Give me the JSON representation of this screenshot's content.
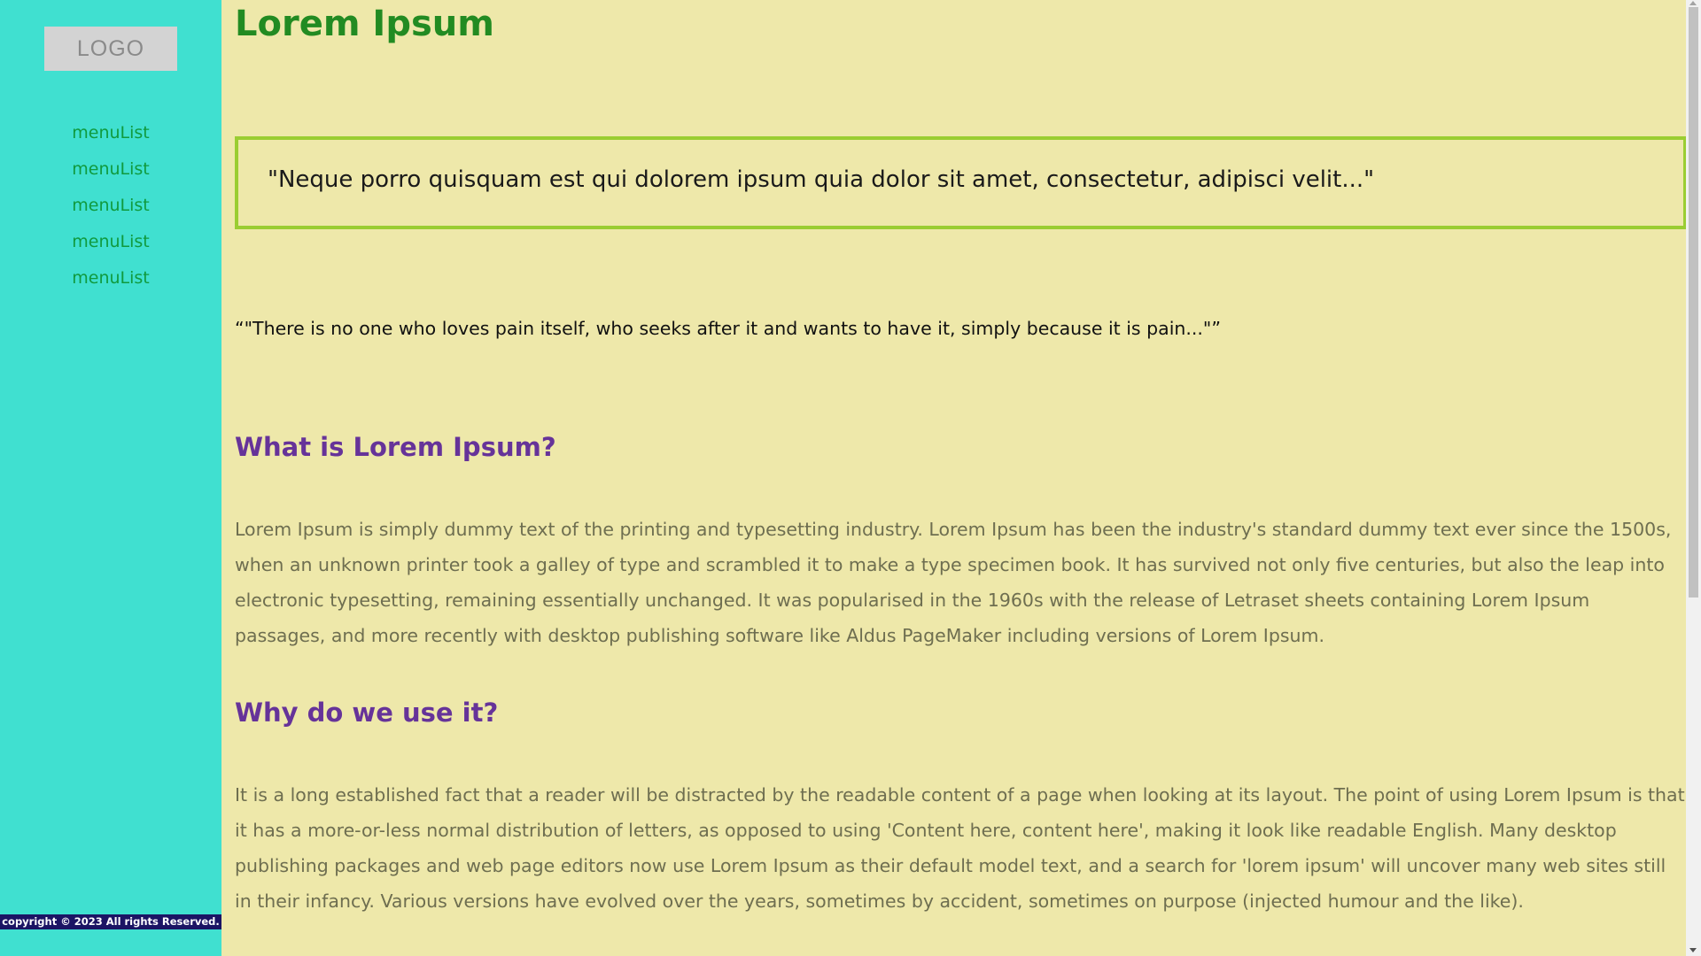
{
  "sidebar": {
    "logo": "LOGO",
    "menu": [
      "menuList",
      "menuList",
      "menuList",
      "menuList",
      "menuList"
    ],
    "copyright": "copyright © 2023 All rights Reserved."
  },
  "main": {
    "title": "Lorem Ipsum",
    "blockquote": "\"Neque porro quisquam est qui dolorem ipsum quia dolor sit amet, consectetur, adipisci velit...\"",
    "quote": "“\"There is no one who loves pain itself, who seeks after it and wants to have it, simply because it is pain...\"”",
    "sections": [
      {
        "heading": "What is Lorem Ipsum?",
        "body": "Lorem Ipsum is simply dummy text of the printing and typesetting industry. Lorem Ipsum has been the industry's standard dummy text ever since the 1500s, when an unknown printer took a galley of type and scrambled it to make a type specimen book. It has survived not only five centuries, but also the leap into electronic typesetting, remaining essentially unchanged. It was popularised in the 1960s with the release of Letraset sheets containing Lorem Ipsum passages, and more recently with desktop publishing software like Aldus PageMaker including versions of Lorem Ipsum."
      },
      {
        "heading": "Why do we use it?",
        "body": "It is a long established fact that a reader will be distracted by the readable content of a page when looking at its layout. The point of using Lorem Ipsum is that it has a more-or-less normal distribution of letters, as opposed to using 'Content here, content here', making it look like readable English. Many desktop publishing packages and web page editors now use Lorem Ipsum as their default model text, and a search for 'lorem ipsum' will uncover many web sites still in their infancy. Various versions have evolved over the years, sometimes by accident, sometimes on purpose (injected humour and the like)."
      }
    ]
  },
  "colors": {
    "page_background": "#eee8aa",
    "sidebar_background": "#40e0d0",
    "title": "#228b22",
    "heading": "#663399",
    "body_text": "#6e6e50",
    "menu_text": "#109a3e",
    "blockquote_border": "#9acd32",
    "copyright_background": "#1b1464"
  }
}
